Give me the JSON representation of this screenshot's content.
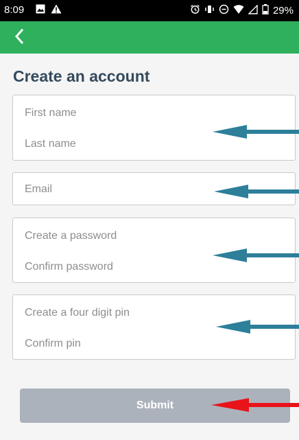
{
  "status_bar": {
    "time": "8:09",
    "battery": "29%",
    "left_icons": [
      "image-icon",
      "warning-icon"
    ],
    "right_icons": [
      "alarm-icon",
      "vibrate-icon",
      "do-not-disturb-icon",
      "wifi-icon",
      "signal-icon",
      "battery-icon"
    ]
  },
  "appbar": {
    "color": "#2fb05c",
    "back_icon": "chevron-left-icon"
  },
  "page": {
    "title": "Create an account"
  },
  "form": {
    "first_name_placeholder": "First name",
    "last_name_placeholder": "Last name",
    "email_placeholder": "Email",
    "password_placeholder": "Create a password",
    "confirm_password_placeholder": "Confirm password",
    "pin_placeholder": "Create a four digit pin",
    "confirm_pin_placeholder": "Confirm pin",
    "submit_label": "Submit"
  },
  "annotations": {
    "field_arrow_color": "#2d7f9a",
    "submit_arrow_color": "#e8141a"
  }
}
